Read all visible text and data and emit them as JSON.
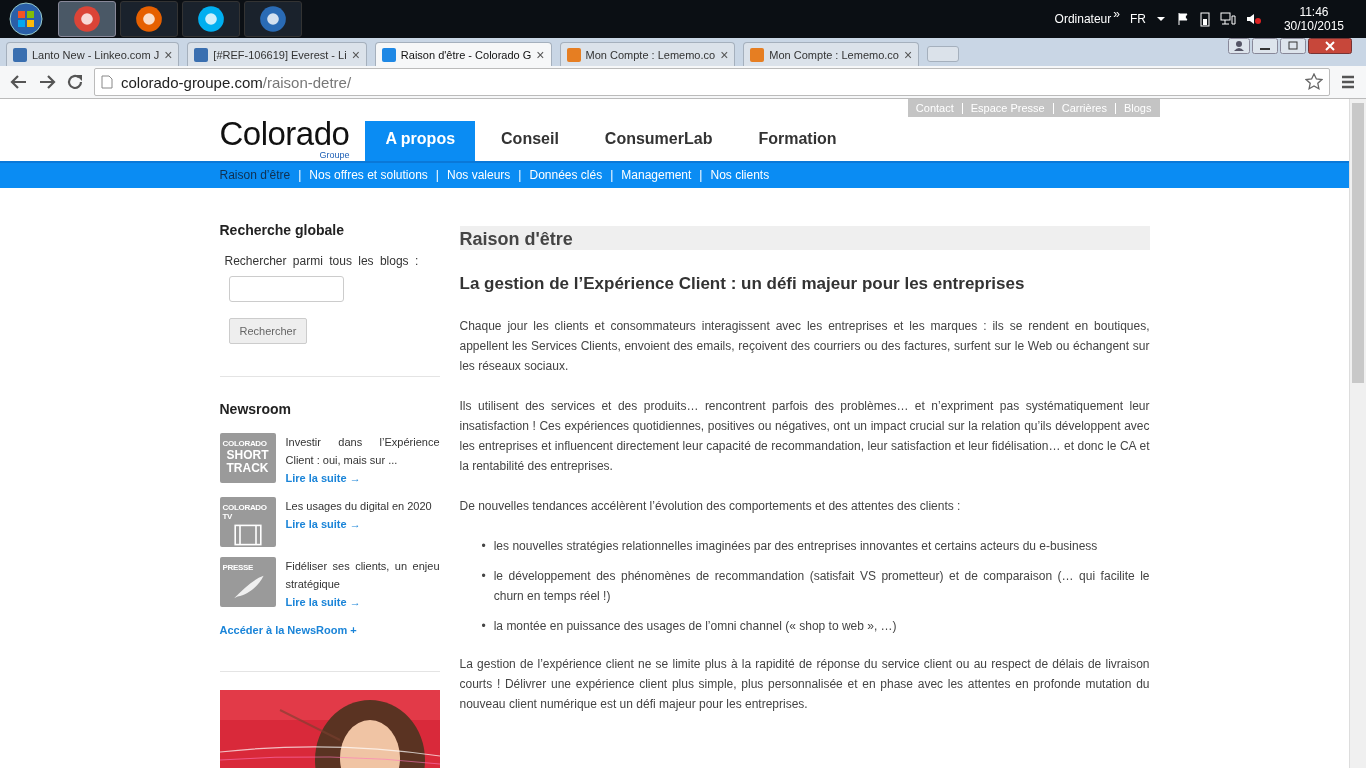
{
  "taskbar": {
    "apps": [
      {
        "kind": "chrome",
        "selected": true
      },
      {
        "kind": "firefox",
        "selected": false
      },
      {
        "kind": "skype",
        "selected": false
      },
      {
        "kind": "thunderbird",
        "selected": false
      }
    ],
    "user": "Ordinateur",
    "chevron": "»",
    "language": "FR",
    "time": "11:46",
    "date": "30/10/2015"
  },
  "tabs": [
    {
      "title": "Lanto New - Linkeo.com J",
      "kind": "linkeo",
      "selected": false
    },
    {
      "title": "[#REF-106619] Everest - Li",
      "kind": "linkeo",
      "selected": false
    },
    {
      "title": "Raison d'être - Colorado G",
      "kind": "colorado",
      "selected": true
    },
    {
      "title": "Mon Compte : Lememo.co",
      "kind": "lememo",
      "selected": false
    },
    {
      "title": "Mon Compte : Lememo.co",
      "kind": "lememo",
      "selected": false
    }
  ],
  "bullet_marker": "•",
  "close_glyph": "×",
  "address": {
    "domain": "colorado-groupe.com",
    "path": "/raison-detre/"
  },
  "utility_links": [
    "Contact",
    "Espace Presse",
    "Carrières",
    "Blogs"
  ],
  "logo": {
    "name": "Colorado",
    "sub": "Groupe"
  },
  "main_nav": [
    {
      "label": "A propos",
      "selected": true
    },
    {
      "label": "Conseil",
      "selected": false
    },
    {
      "label": "ConsumerLab",
      "selected": false
    },
    {
      "label": "Formation",
      "selected": false
    }
  ],
  "sub_nav": [
    {
      "label": "Raison d’être",
      "selected": true
    },
    {
      "label": "Nos offres et solutions",
      "selected": false
    },
    {
      "label": "Nos valeurs",
      "selected": false
    },
    {
      "label": "Données clés",
      "selected": false
    },
    {
      "label": "Management",
      "selected": false
    },
    {
      "label": "Nos clients",
      "selected": false
    }
  ],
  "sub_nav_separator": "|",
  "search": {
    "title": "Recherche globale",
    "label": "Rechercher parmi tous les blogs :",
    "button": "Rechercher"
  },
  "newsroom": {
    "title": "Newsroom",
    "items": [
      {
        "kind": "shorttrack",
        "thumb_top": "COLORADO",
        "thumb_text": "SHORT TRACK",
        "text": "Investir dans l’Expérience Client : oui, mais sur ...",
        "link": "Lire la suite →"
      },
      {
        "kind": "tv",
        "thumb_top": "COLORADO TV",
        "text": "Les usages du digital en 2020",
        "link": "Lire la suite →"
      },
      {
        "kind": "presse",
        "thumb_top": "PRESSE",
        "text": "Fidéliser ses clients, un enjeu stratégique",
        "link": "Lire la suite →"
      }
    ],
    "all_link": "Accéder à la NewsRoom +"
  },
  "banner": {
    "kind": "picture"
  },
  "article": {
    "title": "Raison d'être",
    "heading": "La gestion de l’Expérience Client : un défi majeur pour les entreprises",
    "paragraphs": [
      "Chaque jour les clients et consommateurs interagissent avec les entreprises et les marques : ils se rendent en boutiques, appellent les Services Clients, envoient des emails, reçoivent des courriers ou des factures, surfent sur le Web ou échangent sur les réseaux sociaux.",
      "Ils utilisent des services et des produits… rencontrent parfois des problèmes… et n’expriment pas systématiquement leur insatisfaction ! Ces expériences quotidiennes, positives ou négatives, ont un impact crucial sur la relation qu’ils développent avec les entreprises et influencent directement leur capacité de recommandation, leur satisfaction et leur fidélisation… et donc le CA et la rentabilité des entreprises.",
      "De nouvelles tendances accélèrent l’évolution des comportements et des attentes des clients :"
    ],
    "bullets": [
      "les nouvelles stratégies relationnelles imaginées par des entreprises innovantes et certains acteurs du e-business",
      "le développement des phénomènes de recommandation (satisfait VS prometteur) et de comparaison (… qui facilite le churn en temps réel !)",
      "la montée en puissance des usages de l’omni channel (« shop to web », …)"
    ],
    "closing": "La gestion de l’expérience client ne se limite plus à la rapidité de réponse du service client ou au respect de délais de livraison courts ! Délivrer une expérience client plus simple, plus personnalisée et en phase avec les attentes en profonde mutation du nouveau client numérique est un défi majeur pour les entreprises."
  }
}
